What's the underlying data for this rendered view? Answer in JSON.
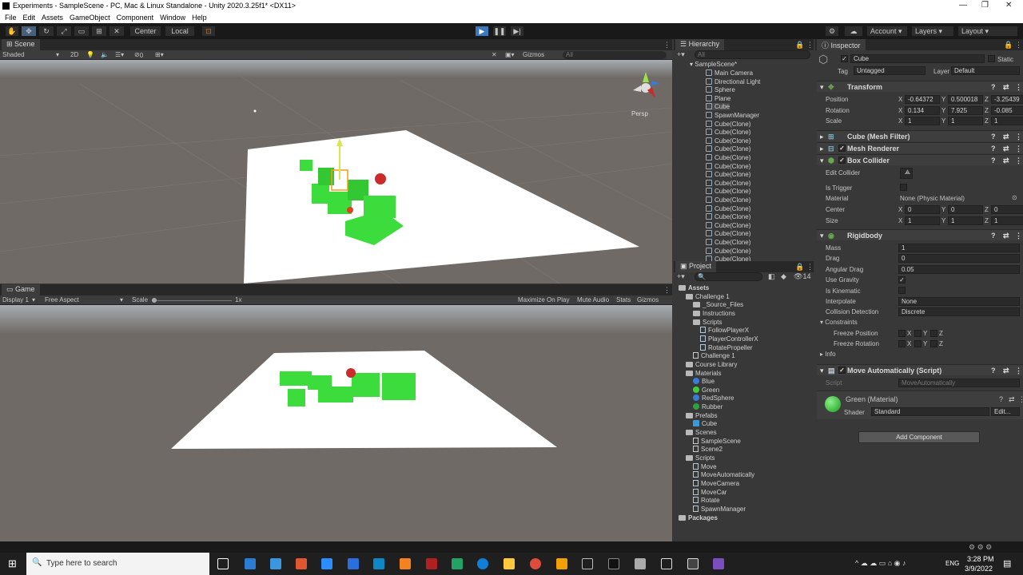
{
  "window": {
    "title": "Experiments - SampleScene - PC, Mac & Linux Standalone - Unity 2020.3.25f1* <DX11>",
    "controls": [
      "—",
      "❐",
      "✕"
    ]
  },
  "menu": [
    "File",
    "Edit",
    "Assets",
    "GameObject",
    "Component",
    "Window",
    "Help"
  ],
  "toolbar": {
    "pivot": "Center",
    "space": "Local",
    "account": "Account",
    "layers": "Layers",
    "layout": "Layout"
  },
  "scene": {
    "tab": "Scene",
    "shading": "Shaded",
    "mode2d": "2D",
    "fx_count": "0",
    "gizmos": "Gizmos",
    "search": "All",
    "persp": "Persp"
  },
  "game": {
    "tab": "Game",
    "display": "Display 1",
    "aspect": "Free Aspect",
    "scale_label": "Scale",
    "scale_value": "1x",
    "maximize": "Maximize On Play",
    "mute": "Mute Audio",
    "stats": "Stats",
    "gizmos": "Gizmos"
  },
  "hierarchy": {
    "tab": "Hierarchy",
    "search": "All",
    "scene": "SampleScene*",
    "items": [
      "Main Camera",
      "Directional Light",
      "Sphere",
      "Plane",
      "Cube",
      "SpawnManager",
      "Cube(Clone)",
      "Cube(Clone)",
      "Cube(Clone)",
      "Cube(Clone)",
      "Cube(Clone)",
      "Cube(Clone)",
      "Cube(Clone)",
      "Cube(Clone)",
      "Cube(Clone)",
      "Cube(Clone)",
      "Cube(Clone)",
      "Cube(Clone)",
      "Cube(Clone)",
      "Cube(Clone)",
      "Cube(Clone)",
      "Cube(Clone)",
      "Cube(Clone)"
    ]
  },
  "project": {
    "tab": "Project",
    "count": "14",
    "items": [
      {
        "label": "Assets",
        "kind": "folder",
        "depth": 0,
        "bold": true
      },
      {
        "label": "Challenge 1",
        "kind": "folder",
        "depth": 1
      },
      {
        "label": "_Source_Files",
        "kind": "folder",
        "depth": 2
      },
      {
        "label": "Instructions",
        "kind": "folder",
        "depth": 2
      },
      {
        "label": "Scripts",
        "kind": "folder",
        "depth": 2
      },
      {
        "label": "FollowPlayerX",
        "kind": "script",
        "depth": 3
      },
      {
        "label": "PlayerControllerX",
        "kind": "script",
        "depth": 3
      },
      {
        "label": "RotatePropeller",
        "kind": "script",
        "depth": 3
      },
      {
        "label": "Challenge 1",
        "kind": "scene",
        "depth": 2
      },
      {
        "label": "Course Library",
        "kind": "folder",
        "depth": 1
      },
      {
        "label": "Materials",
        "kind": "folder",
        "depth": 1
      },
      {
        "label": "Blue",
        "kind": "material",
        "depth": 2,
        "color": "#3a7bd5"
      },
      {
        "label": "Green",
        "kind": "material",
        "depth": 2,
        "color": "#3ecf3e"
      },
      {
        "label": "RedSphere",
        "kind": "material",
        "depth": 2,
        "color": "#3a7bd5"
      },
      {
        "label": "Rubber",
        "kind": "material",
        "depth": 2,
        "color": "#2ea043"
      },
      {
        "label": "Prefabs",
        "kind": "folder",
        "depth": 1
      },
      {
        "label": "Cube",
        "kind": "prefab",
        "depth": 2
      },
      {
        "label": "Scenes",
        "kind": "folder",
        "depth": 1
      },
      {
        "label": "SampleScene",
        "kind": "scene",
        "depth": 2
      },
      {
        "label": "Scene2",
        "kind": "scene",
        "depth": 2
      },
      {
        "label": "Scripts",
        "kind": "folder",
        "depth": 1
      },
      {
        "label": "Move",
        "kind": "script",
        "depth": 2
      },
      {
        "label": "MoveAutomatically",
        "kind": "script",
        "depth": 2
      },
      {
        "label": "MoveCamera",
        "kind": "script",
        "depth": 2
      },
      {
        "label": "MoveCar",
        "kind": "script",
        "depth": 2
      },
      {
        "label": "Rotate",
        "kind": "script",
        "depth": 2
      },
      {
        "label": "SpawnManager",
        "kind": "script",
        "depth": 2
      },
      {
        "label": "Packages",
        "kind": "folder",
        "depth": 0,
        "bold": true
      }
    ]
  },
  "inspector": {
    "tab": "Inspector",
    "name": "Cube",
    "static": "Static",
    "tag_label": "Tag",
    "tag": "Untagged",
    "layer_label": "Layer",
    "layer": "Default",
    "transform": {
      "title": "Transform",
      "position_label": "Position",
      "rotation_label": "Rotation",
      "scale_label": "Scale",
      "position": [
        "-0.64372",
        "0.500018",
        "-3.25439"
      ],
      "rotation": [
        "0.134",
        "7.925",
        "-0.085"
      ],
      "scale": [
        "1",
        "1",
        "1"
      ]
    },
    "mesh_filter": "Cube (Mesh Filter)",
    "mesh_renderer": "Mesh Renderer",
    "box_collider": {
      "title": "Box Collider",
      "edit_collider": "Edit Collider",
      "is_trigger": "Is Trigger",
      "material_label": "Material",
      "material": "None (Physic Material)",
      "center_label": "Center",
      "size_label": "Size",
      "center": [
        "0",
        "0",
        "0"
      ],
      "size": [
        "1",
        "1",
        "1"
      ]
    },
    "rigidbody": {
      "title": "Rigidbody",
      "mass_label": "Mass",
      "mass": "1",
      "drag_label": "Drag",
      "drag": "0",
      "angular_drag_label": "Angular Drag",
      "angular_drag": "0.05",
      "use_gravity": "Use Gravity",
      "is_kinematic": "Is Kinematic",
      "interpolate_label": "Interpolate",
      "interpolate": "None",
      "collision_label": "Collision Detection",
      "collision": "Discrete",
      "constraints": "Constraints",
      "freeze_position": "Freeze Position",
      "freeze_rotation": "Freeze Rotation",
      "info": "Info"
    },
    "script": {
      "title": "Move Automatically (Script)",
      "label": "Script",
      "value": "MoveAutomatically"
    },
    "material": {
      "title": "Green (Material)",
      "shader_label": "Shader",
      "shader": "Standard",
      "edit": "Edit..."
    },
    "add_component": "Add Component"
  },
  "taskbar": {
    "search": "Type here to search",
    "time": "3:28 PM",
    "date": "3/9/2022",
    "lang": "ENG"
  },
  "colors": {
    "accent_play": "#3a79bb",
    "ground": "#6f6a66",
    "plane": "#ffffff",
    "cube": "#3ddc3d",
    "sphere": "#cc2b2b"
  }
}
